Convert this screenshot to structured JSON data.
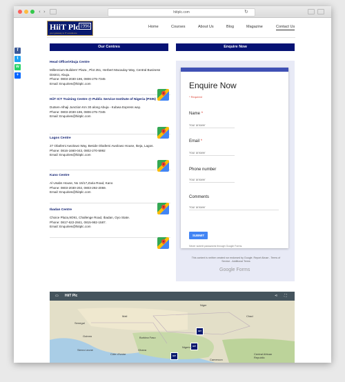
{
  "browser": {
    "url": "hiitplc.com"
  },
  "header": {
    "logo_text": "HiiT Plc",
    "logo_year": "1996",
    "logo_tagline": "your gateway to IT excellence",
    "nav": [
      "Home",
      "Courses",
      "About Us",
      "Blog",
      "Magazine",
      "Contact Us"
    ],
    "active_nav": "Contact Us"
  },
  "section_headers": {
    "centres": "Our Centres",
    "enquire": "Enquire Now"
  },
  "share_icons": [
    "facebook-icon",
    "twitter-icon",
    "whatsapp-icon",
    "share-plus-icon"
  ],
  "centres": [
    {
      "name": "Head Office/Abuja Centre",
      "address": "Millennium Builders' Plaza , Plot 251, Herbert Macaulay Way, Central Business District, Abuja.",
      "phone": "Phone: 0803-2030-196, 0806-275-7345",
      "email": "Email: Enquiries@hiitplc.com"
    },
    {
      "name": "HiiT ICT Training Centre @ Public Service Institute of Nigeria (PSIN)",
      "address": "Dutsen-Alhaji Junction Km 30 along Abuja - Kubwa Express way.",
      "phone": "Phone: 0803-2030-196, 0806-275-7345",
      "email": "Email: Enquiries@hiitplc.com"
    },
    {
      "name": "Lagos Centre",
      "address": "27 Obafemi Awolowo Way, Beside Obafemi Awolowo House, Ikeja, Lagos.",
      "phone": "Phone: 0816-1660-043, 0802-270-5992",
      "email": "Email: Enquiries@hiitplc.com"
    },
    {
      "name": "Kano Centre",
      "address": "Al Usabs House, No 15/17,Zaria Road, Kano",
      "phone": "Phone: 0803-2030-202, 0803-292-2059.",
      "email": "Email: Enquiries@hiitplc.com"
    },
    {
      "name": "Ibadan Centre",
      "address": "Choice Plaza,9O91, Challenge Road, Ibadan, Oyo State.",
      "phone": "Phone: 0817-622-2841, 0815-982-1587.",
      "email": "Email: Enquiries@hiitplc.com"
    }
  ],
  "form": {
    "title": "Enquire Now",
    "required_note": "* Required",
    "fields": [
      {
        "label": "Name",
        "required": true,
        "placeholder": "Your answer"
      },
      {
        "label": "Email",
        "required": true,
        "placeholder": "Your answer"
      },
      {
        "label": "Phone number",
        "required": false,
        "placeholder": "Your answer"
      },
      {
        "label": "Comments",
        "required": false,
        "placeholder": "Your answer"
      }
    ],
    "submit_label": "SUBMIT",
    "never_submit": "Never submit passwords through Google Forms.",
    "disclaimer": "This content is neither created nor endorsed by Google. Report Abuse - Terms of Service - Additional Terms",
    "brand": "Google Forms"
  },
  "map": {
    "title": "HiiT Plc",
    "labels": [
      "Niger",
      "Chad",
      "Mali",
      "Senegal",
      "Guinea",
      "Sierra Leone",
      "Côte d'Ivoire",
      "Ghana",
      "Burkina Faso",
      "Nigeria",
      "Cameroon",
      "Central African Republic"
    ],
    "marker_text": "HiiT"
  },
  "colors": {
    "navy": "#061274",
    "form_accent": "#3f51b5",
    "submit": "#4285f4",
    "required": "#db4437"
  }
}
